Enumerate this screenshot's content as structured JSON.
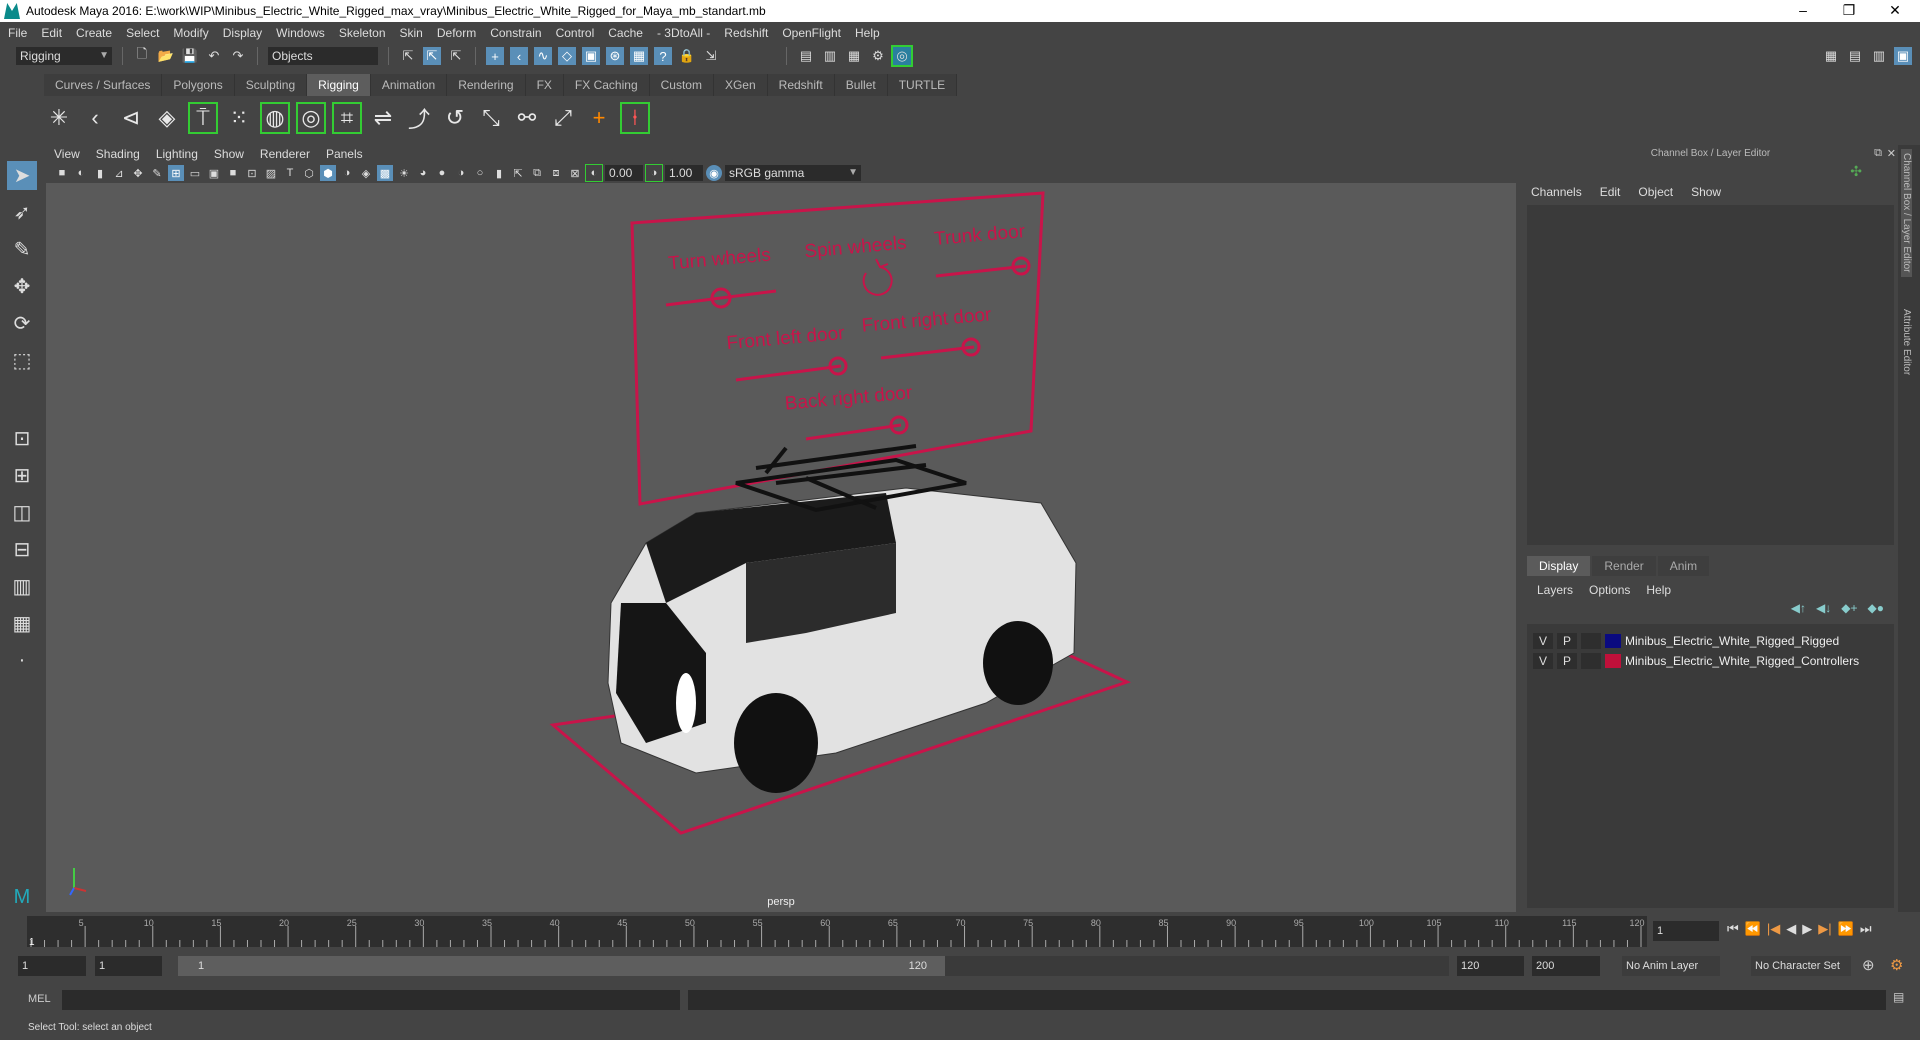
{
  "title": "Autodesk Maya 2016: E:\\work\\WIP\\Minibus_Electric_White_Rigged_max_vray\\Minibus_Electric_White_Rigged_for_Maya_mb_standart.mb",
  "menus": [
    "File",
    "Edit",
    "Create",
    "Select",
    "Modify",
    "Display",
    "Windows",
    "Skeleton",
    "Skin",
    "Deform",
    "Constrain",
    "Control",
    "Cache",
    "- 3DtoAll -",
    "Redshift",
    "OpenFlight",
    "Help"
  ],
  "status_line": {
    "mode": "Rigging",
    "objects": "Objects"
  },
  "shelf_tabs": [
    "Curves / Surfaces",
    "Polygons",
    "Sculpting",
    "Rigging",
    "Animation",
    "Rendering",
    "FX",
    "FX Caching",
    "Custom",
    "XGen",
    "Redshift",
    "Bullet",
    "TURTLE"
  ],
  "active_shelf": "Rigging",
  "panel_menu": [
    "View",
    "Shading",
    "Lighting",
    "Show",
    "Renderer",
    "Panels"
  ],
  "viewport_toolbar": {
    "exposure": "0.00",
    "gamma": "1.00",
    "color_space": "sRGB gamma"
  },
  "viewport": {
    "camera": "persp"
  },
  "rig_board": {
    "labels": [
      "Turn wheels",
      "Spin wheels",
      "Trunk door",
      "Front left door",
      "Front right door",
      "Back right door"
    ],
    "color": "#c8144a"
  },
  "channel_box": {
    "title": "Channel Box / Layer Editor",
    "menus": [
      "Channels",
      "Edit",
      "Object",
      "Show"
    ]
  },
  "layer_editor": {
    "tabs": [
      "Display",
      "Render",
      "Anim"
    ],
    "active_tab": "Display",
    "menus": [
      "Layers",
      "Options",
      "Help"
    ],
    "layers": [
      {
        "v": "V",
        "p": "P",
        "color": "#0a0a80",
        "name": "Minibus_Electric_White_Rigged_Rigged"
      },
      {
        "v": "V",
        "p": "P",
        "color": "#c0103a",
        "name": "Minibus_Electric_White_Rigged_Controllers"
      }
    ]
  },
  "side_tabs": [
    "Channel Box / Layer Editor",
    "Attribute Editor"
  ],
  "timeline": {
    "start": 1,
    "end": 120,
    "current": "1",
    "labels": [
      "5",
      "10",
      "15",
      "20",
      "25",
      "30",
      "35",
      "40",
      "45",
      "50",
      "55",
      "60",
      "65",
      "70",
      "75",
      "80",
      "85",
      "90",
      "95",
      "100",
      "105",
      "110",
      "115",
      "120"
    ]
  },
  "range": {
    "start": "1",
    "playback_start": "1",
    "slider_start": "1",
    "slider_end": "120",
    "playback_end": "120",
    "end": "200",
    "anim_layer": "No Anim Layer",
    "character_set": "No Character Set"
  },
  "command": {
    "label": "MEL"
  },
  "status": "Select Tool: select an object"
}
